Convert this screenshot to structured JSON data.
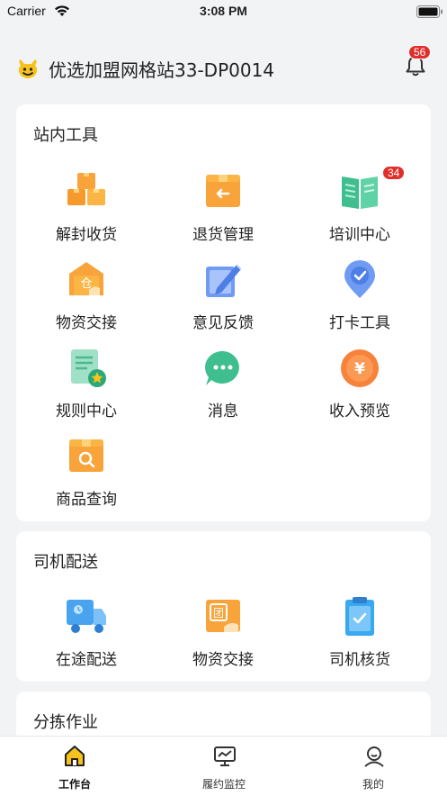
{
  "status_bar": {
    "carrier": "Carrier",
    "time": "3:08 PM"
  },
  "header": {
    "title": "优选加盟网格站33-DP0014",
    "notification_count": "56"
  },
  "sections": [
    {
      "title": "站内工具",
      "items": [
        {
          "label": "解封收货",
          "icon": "boxes-icon"
        },
        {
          "label": "退货管理",
          "icon": "return-box-icon"
        },
        {
          "label": "培训中心",
          "icon": "book-icon",
          "badge": "34"
        },
        {
          "label": "物资交接",
          "icon": "warehouse-handover-icon"
        },
        {
          "label": "意见反馈",
          "icon": "pencil-note-icon"
        },
        {
          "label": "打卡工具",
          "icon": "location-check-icon"
        },
        {
          "label": "规则中心",
          "icon": "rules-doc-icon"
        },
        {
          "label": "消息",
          "icon": "chat-bubble-icon"
        },
        {
          "label": "收入预览",
          "icon": "yuan-coin-icon"
        },
        {
          "label": "商品查询",
          "icon": "search-box-icon"
        }
      ]
    },
    {
      "title": "司机配送",
      "items": [
        {
          "label": "在途配送",
          "icon": "delivery-truck-icon"
        },
        {
          "label": "物资交接",
          "icon": "group-handover-icon"
        },
        {
          "label": "司机核货",
          "icon": "clipboard-check-icon"
        }
      ]
    },
    {
      "title": "分拣作业",
      "items": []
    }
  ],
  "tabbar": [
    {
      "label": "工作台",
      "icon": "home-icon",
      "active": true
    },
    {
      "label": "履约监控",
      "icon": "monitor-chart-icon",
      "active": false
    },
    {
      "label": "我的",
      "icon": "profile-icon",
      "active": false
    }
  ],
  "colors": {
    "accent": "#f7c21b",
    "badge": "#e02f2b",
    "background": "#f2f3f5"
  }
}
